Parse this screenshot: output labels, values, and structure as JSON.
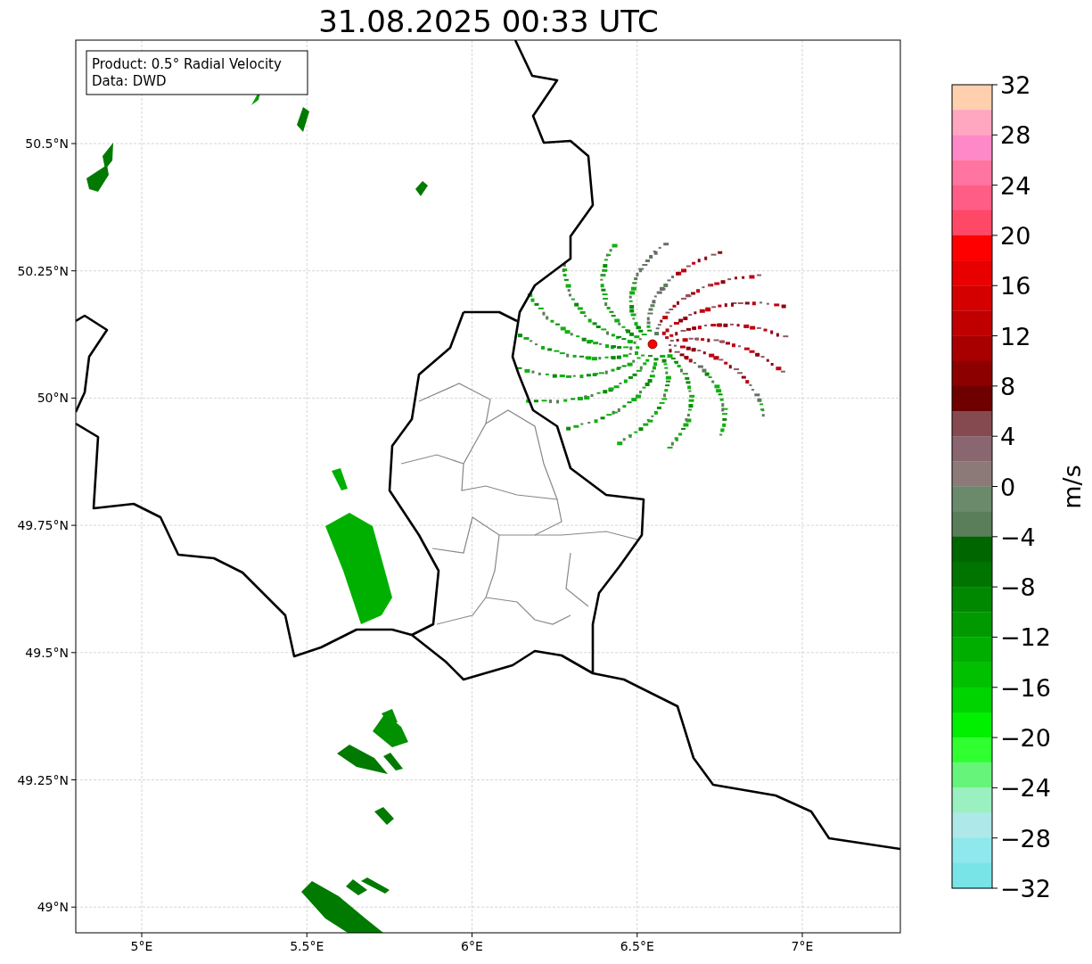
{
  "title": "31.08.2025 00:33 UTC",
  "info_box": [
    "Product: 0.5° Radial Velocity",
    "Data: DWD"
  ],
  "y_ticks": [
    "50.5°N",
    "50.25°N",
    "50°N",
    "49.75°N",
    "49.5°N",
    "49.25°N",
    "49°N"
  ],
  "x_ticks": [
    "5°E",
    "5.5°E",
    "6°E",
    "6.5°E",
    "7°E"
  ],
  "colorbar": {
    "label": "m/s",
    "ticks": [
      "32",
      "28",
      "24",
      "20",
      "16",
      "12",
      "8",
      "4",
      "0",
      "−4",
      "−8",
      "−12",
      "−16",
      "−20",
      "−24",
      "−28",
      "−32"
    ],
    "segments": [
      {
        "color": "#ffcfae"
      },
      {
        "color": "#ffa6c0"
      },
      {
        "color": "#ff88c8"
      },
      {
        "color": "#ff74a0"
      },
      {
        "color": "#ff5c86"
      },
      {
        "color": "#ff4766"
      },
      {
        "color": "#ff0000"
      },
      {
        "color": "#e80000"
      },
      {
        "color": "#d40000"
      },
      {
        "color": "#c00000"
      },
      {
        "color": "#a80000"
      },
      {
        "color": "#8c0000"
      },
      {
        "color": "#6e0000"
      },
      {
        "color": "#844a50"
      },
      {
        "color": "#8a6670"
      },
      {
        "color": "#8c7a78"
      },
      {
        "color": "#6b8a6b"
      },
      {
        "color": "#5a7d5a"
      },
      {
        "color": "#006600"
      },
      {
        "color": "#007400"
      },
      {
        "color": "#008800"
      },
      {
        "color": "#009a00"
      },
      {
        "color": "#00ae00"
      },
      {
        "color": "#00c000"
      },
      {
        "color": "#00d400"
      },
      {
        "color": "#00f000"
      },
      {
        "color": "#30ff30"
      },
      {
        "color": "#66f57a"
      },
      {
        "color": "#9af0c0"
      },
      {
        "color": "#aee8e8"
      },
      {
        "color": "#8ee8ec"
      },
      {
        "color": "#78e4e8"
      }
    ]
  }
}
